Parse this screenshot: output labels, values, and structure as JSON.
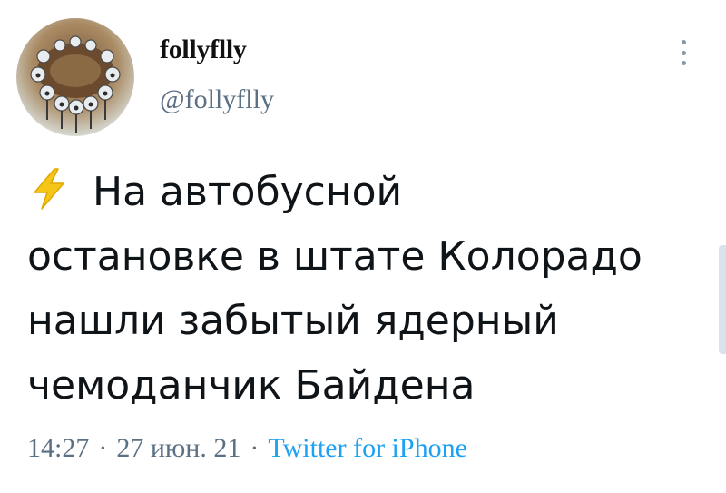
{
  "author": {
    "display_name": "follyflly",
    "handle": "@follyflly"
  },
  "tweet": {
    "lines": [
      "На  автобусной",
      "остановке в штате Колорадо",
      "нашли забытый ядерный",
      "чемоданчик Байдена"
    ],
    "lead_icon": "lightning-bolt-icon"
  },
  "meta": {
    "time": "14:27",
    "date": "27 июн. 21",
    "separator": "·",
    "source": "Twitter for iPhone"
  },
  "icons": {
    "menu": "more-vertical-icon",
    "avatar": "avatar-image"
  },
  "colors": {
    "handle": "#5b7083",
    "source_link": "#1da1f2",
    "bolt": "#f5c518"
  }
}
